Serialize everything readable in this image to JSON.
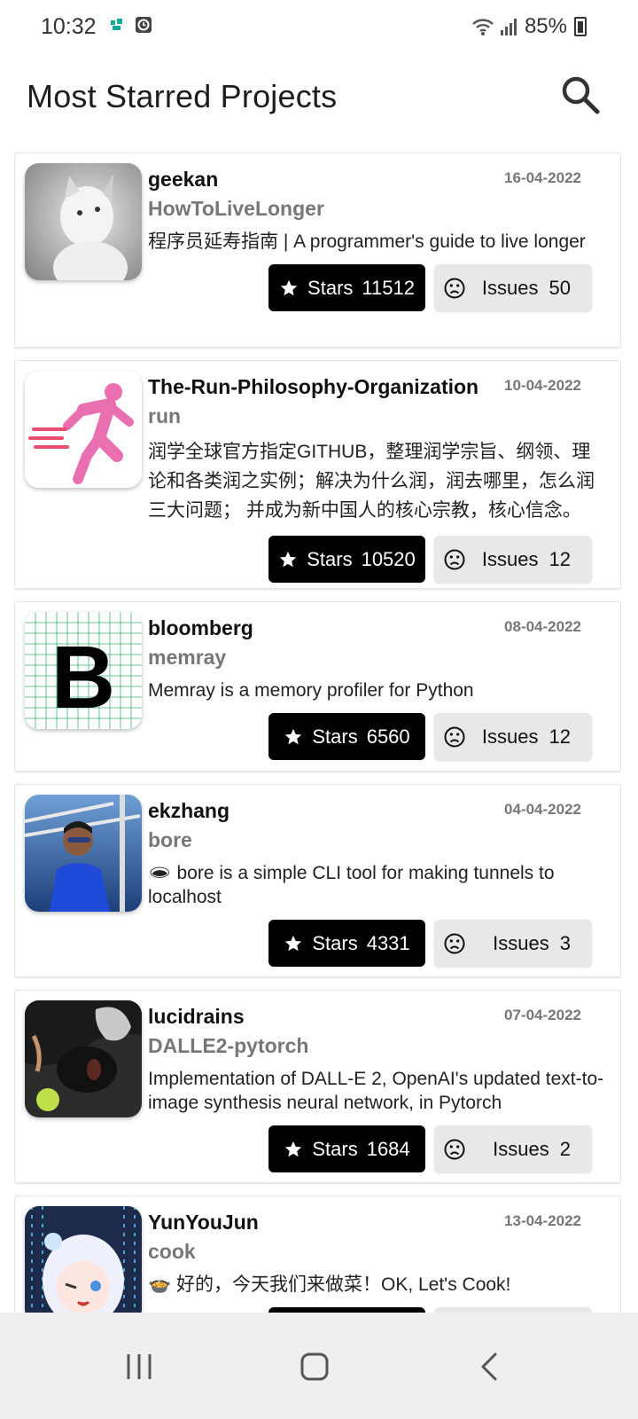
{
  "status_bar": {
    "time": "10:32",
    "battery": "85%"
  },
  "header": {
    "title": "Most Starred Projects"
  },
  "labels": {
    "stars": "Stars",
    "issues": "Issues"
  },
  "projects": [
    {
      "owner": "geekan",
      "repo": "HowToLiveLonger",
      "date": "16-04-2022",
      "description": "程序员延寿指南 | A programmer's guide to live longer",
      "stars": "11512",
      "issues": "50"
    },
    {
      "owner": "The-Run-Philosophy-Organization",
      "repo": "run",
      "date": "10-04-2022",
      "description": "润学全球官方指定GITHUB，整理润学宗旨、纲领、理论和各类润之实例；解决为什么润，润去哪里，怎么润三大问题； 并成为新中国人的核心宗教，核心信念。",
      "stars": "10520",
      "issues": "12"
    },
    {
      "owner": "bloomberg",
      "repo": "memray",
      "date": "08-04-2022",
      "description": "Memray is a memory profiler for Python",
      "stars": "6560",
      "issues": "12"
    },
    {
      "owner": "ekzhang",
      "repo": "bore",
      "date": "04-04-2022",
      "description": "🕳 bore is a simple CLI tool for making tunnels to localhost",
      "stars": "4331",
      "issues": "3"
    },
    {
      "owner": "lucidrains",
      "repo": "DALLE2-pytorch",
      "date": "07-04-2022",
      "description": "Implementation of DALL-E 2, OpenAI's updated text-to-image synthesis neural network,  in Pytorch",
      "stars": "1684",
      "issues": "2"
    },
    {
      "owner": "YunYouJun",
      "repo": "cook",
      "date": "13-04-2022",
      "description": "🍲 好的，今天我们来做菜！OK, Let's Cook!",
      "stars": "",
      "issues": ""
    }
  ],
  "icons": {
    "search": "search-icon",
    "star": "star-icon",
    "issues": "sad-face-icon",
    "nav_recents": "recent-apps-icon",
    "nav_home": "home-icon",
    "nav_back": "back-icon"
  }
}
